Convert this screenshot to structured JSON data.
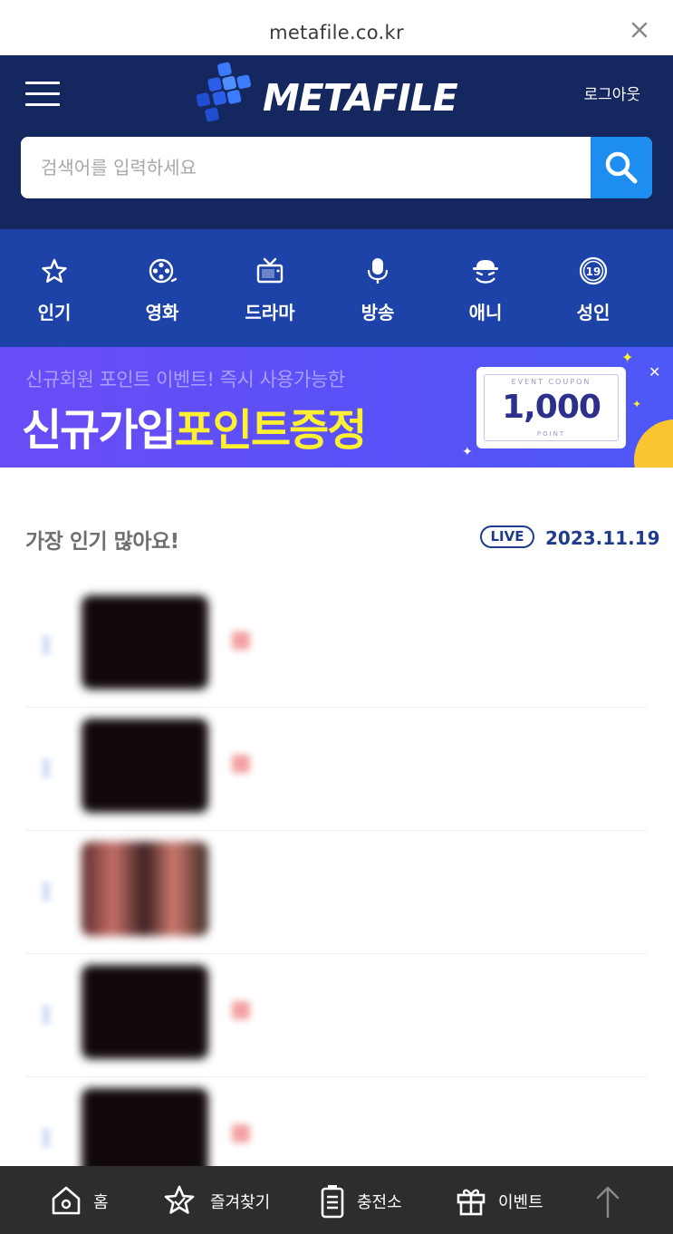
{
  "browser": {
    "url": "metafile.co.kr",
    "close_icon": "close-icon"
  },
  "header": {
    "logo_text": "METAFILE",
    "logout_label": "로그아웃",
    "menu_icon": "hamburger-icon"
  },
  "search": {
    "placeholder": "검색어를 입력하세요",
    "value": "",
    "icon": "search-icon"
  },
  "categories": [
    {
      "label": "인기",
      "icon": "star-icon"
    },
    {
      "label": "영화",
      "icon": "film-reel-icon"
    },
    {
      "label": "드라마",
      "icon": "tv-icon"
    },
    {
      "label": "방송",
      "icon": "microphone-icon"
    },
    {
      "label": "애니",
      "icon": "character-icon"
    },
    {
      "label": "성인",
      "icon": "age-19-icon"
    }
  ],
  "banner": {
    "subtitle": "신규회원 포인트 이벤트! 즉시 사용가능한",
    "title_white": "신규가입",
    "title_yellow": "포인트증정",
    "coupon_top": "EVENT COUPON",
    "coupon_amount": "1,000",
    "coupon_bottom": "POINT"
  },
  "popular": {
    "title": "가장 인기 많아요!",
    "live_badge": "LIVE",
    "date": "2023.11.19",
    "items": [
      {
        "title": ""
      },
      {
        "title": ""
      },
      {
        "title": ""
      },
      {
        "title": ""
      },
      {
        "title": ""
      }
    ]
  },
  "bottom_nav": [
    {
      "label": "홈",
      "icon": "home-icon"
    },
    {
      "label": "즐겨찾기",
      "icon": "star-icon"
    },
    {
      "label": "충전소",
      "icon": "battery-icon"
    },
    {
      "label": "이벤트",
      "icon": "gift-icon"
    },
    {
      "label": "",
      "icon": "arrow-up-icon"
    }
  ],
  "colors": {
    "header_bg": "#15275f",
    "category_bg": "#1d43a9",
    "search_button": "#1d8df0",
    "banner_bg": "#5b50f7",
    "banner_highlight": "#fdf031",
    "accent_text": "#1f3b8c",
    "bottom_nav_bg": "#2d2d2d"
  }
}
